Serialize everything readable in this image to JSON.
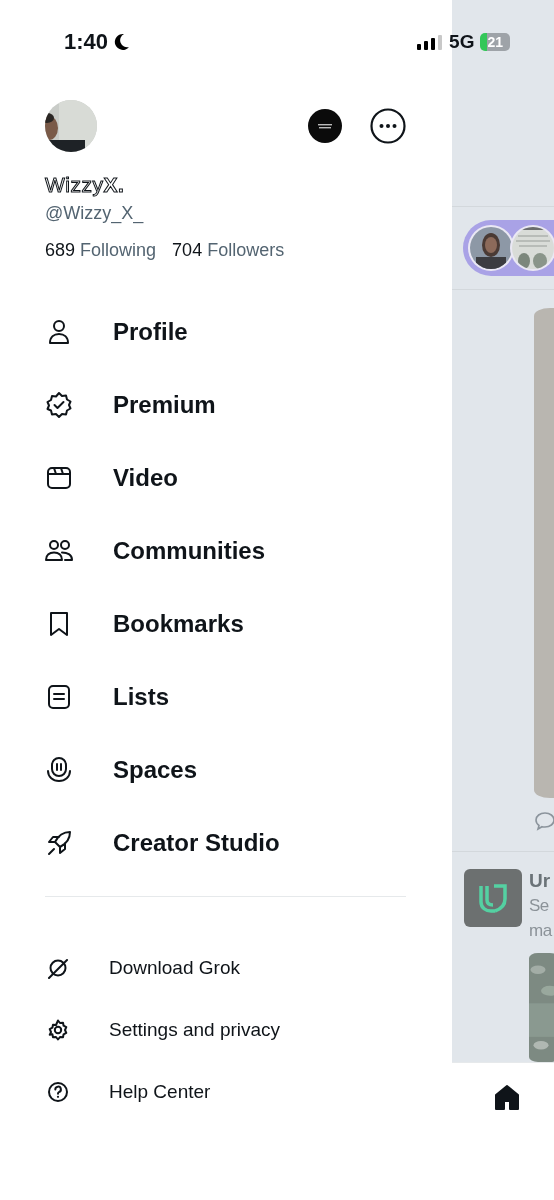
{
  "status_bar": {
    "time": "1:40",
    "network": "5G",
    "battery": "21"
  },
  "account": {
    "name": "Wizzy**X.**",
    "handle": "@Wizzy_X_",
    "following_count": "689",
    "following_label": "Following",
    "followers_count": "704",
    "followers_label": "Followers"
  },
  "menu": [
    {
      "label": "Profile"
    },
    {
      "label": "Premium"
    },
    {
      "label": "Video"
    },
    {
      "label": "Communities"
    },
    {
      "label": "Bookmarks"
    },
    {
      "label": "Lists"
    },
    {
      "label": "Spaces"
    },
    {
      "label": "Creator Studio"
    }
  ],
  "secondary_menu": [
    {
      "label": "Download Grok"
    },
    {
      "label": "Settings and privacy"
    },
    {
      "label": "Help Center"
    }
  ],
  "background_feed": {
    "post_title": "Ur",
    "post_line_1": "Se",
    "post_line_2": "ma"
  },
  "bottom_nav": [
    {
      "selected": true
    }
  ]
}
